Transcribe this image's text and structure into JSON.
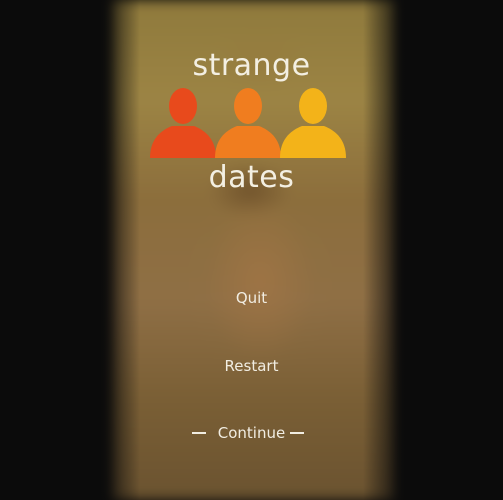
{
  "game": {
    "title_line1": "strange",
    "title_line2": "dates",
    "logo": {
      "figures": [
        {
          "name": "person-icon-red",
          "color": "#e84a1c"
        },
        {
          "name": "person-icon-orange",
          "color": "#f07d1f"
        },
        {
          "name": "person-icon-yellow",
          "color": "#f3b319"
        }
      ]
    }
  },
  "menu": {
    "items": [
      {
        "label": "Quit",
        "selected": false
      },
      {
        "label": "Restart",
        "selected": false
      },
      {
        "label": "Continue",
        "selected": true
      }
    ]
  }
}
